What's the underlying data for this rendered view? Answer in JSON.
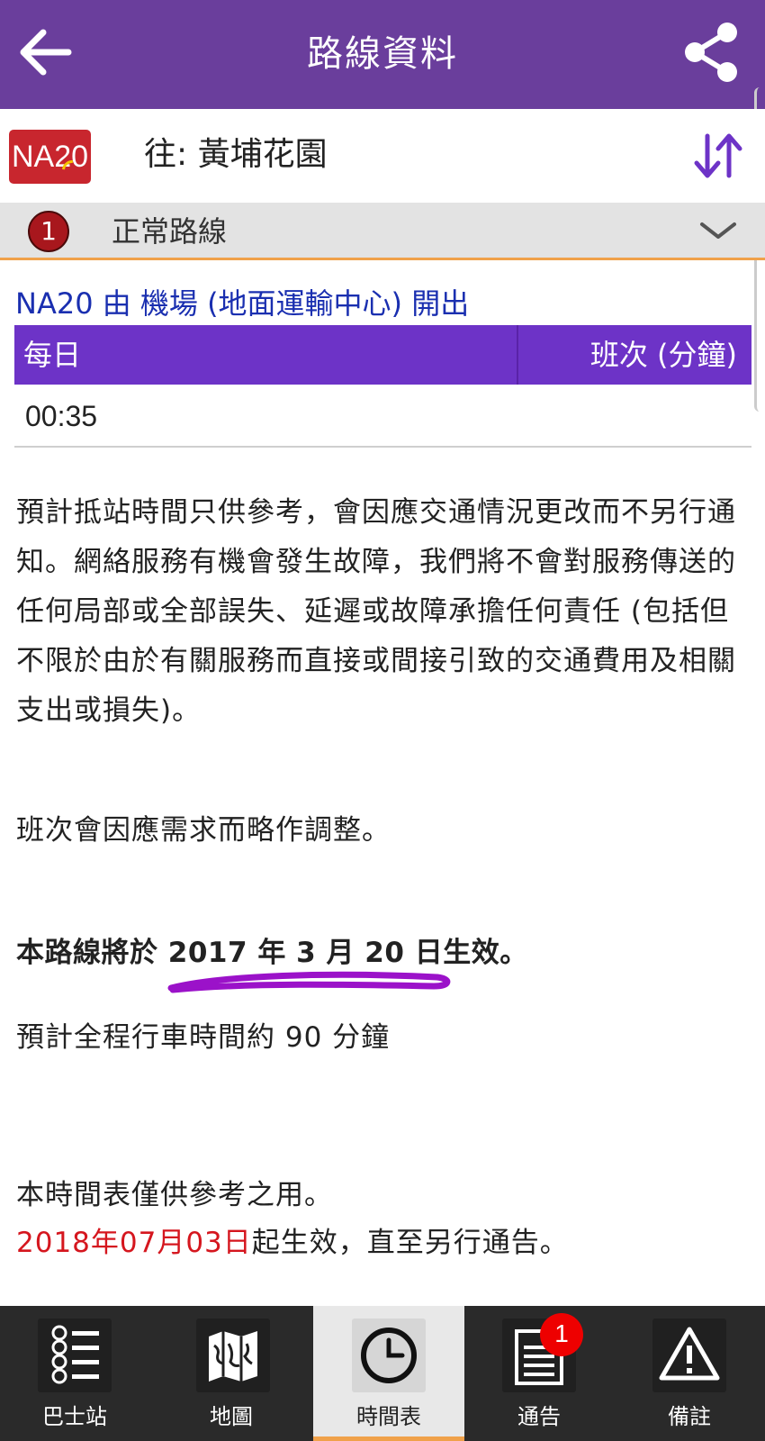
{
  "header": {
    "title": "路線資料",
    "back_icon": "arrow-left-icon",
    "share_icon": "share-icon",
    "bar_color": "#6a3e9c"
  },
  "route": {
    "badge": "NA20",
    "badge_color": "#c8262e",
    "destination": "往: 黃埔花園",
    "swap_icon": "swap-direction-icon"
  },
  "variant": {
    "number": "1",
    "label": "正常路線",
    "expand_icon": "chevron-down-icon"
  },
  "departure_title": "NA20 由 機場 (地面運輸中心) 開出",
  "schedule": {
    "header_day": "每日",
    "header_freq": "班次 (分鐘)",
    "rows": [
      "00:35"
    ]
  },
  "notes": {
    "disclaimer": "預計抵站時間只供參考，會因應交通情況更改而不另行通知。網絡服務有機會發生故障，我們將不會對服務傳送的任何局部或全部誤失、延遲或故障承擔任何責任 (包括但不限於由於有關服務而直接或間接引致的交通費用及相關支出或損失)。",
    "adjust": "班次會因應需求而略作調整。",
    "effective": "本路線將於 2017 年 3 月 20 日生效。",
    "journey_time": "預計全程行車時間約 90 分鐘",
    "reference": "本時間表僅供參考之用。",
    "effective_date": "2018年07月03日",
    "effective_suffix": "起生效，直至另行通告。"
  },
  "bottom_nav": {
    "items": [
      {
        "label": "巴士站",
        "icon": "bus-stops-list-icon",
        "active": false
      },
      {
        "label": "地圖",
        "icon": "map-icon",
        "active": false
      },
      {
        "label": "時間表",
        "icon": "clock-icon",
        "active": true
      },
      {
        "label": "通告",
        "icon": "notice-document-icon",
        "active": false,
        "badge": "1"
      },
      {
        "label": "備註",
        "icon": "warning-icon",
        "active": false
      }
    ]
  }
}
